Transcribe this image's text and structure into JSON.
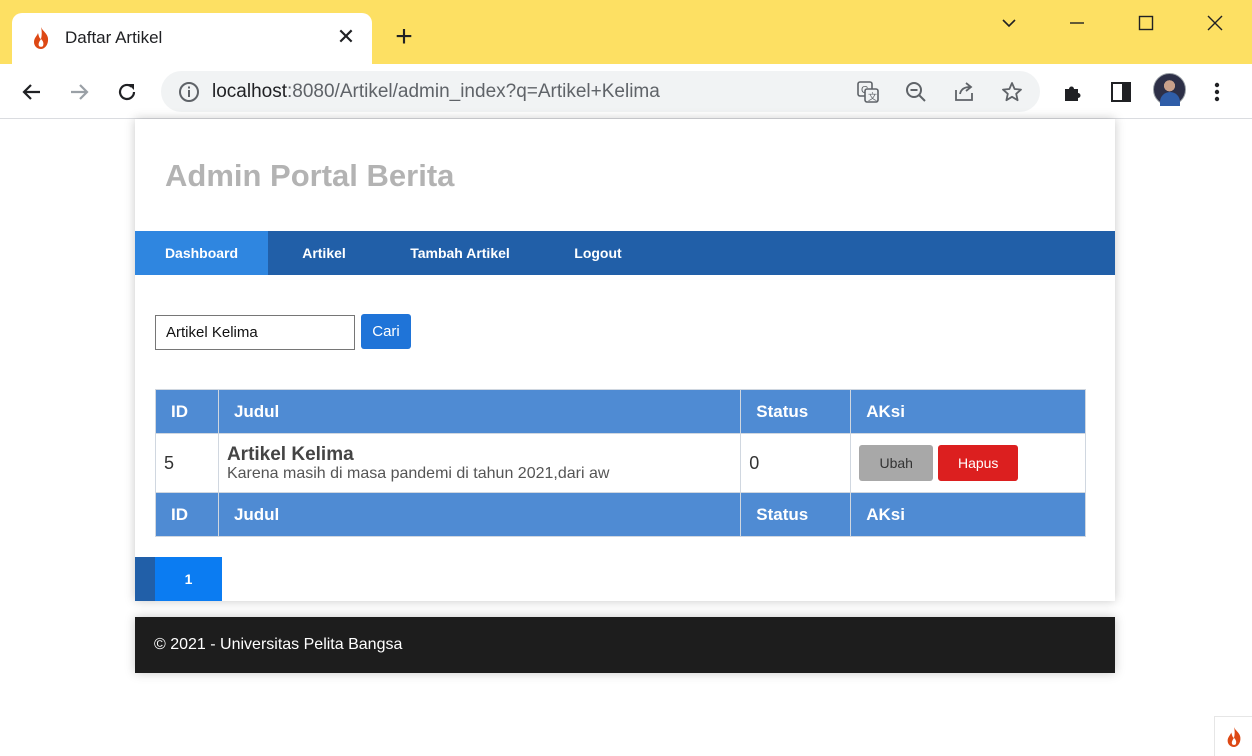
{
  "browser": {
    "tab_title": "Daftar Artikel",
    "tab_close": "✕",
    "new_tab": "+",
    "url_host": "localhost",
    "url_rest": ":8080/Artikel/admin_index?q=Artikel+Kelima",
    "colors": {
      "titlebar": "#fde063",
      "omnibox": "#f1f3f4"
    }
  },
  "site": {
    "title": "Admin Portal Berita",
    "nav": [
      {
        "label": "Dashboard",
        "active": true
      },
      {
        "label": "Artikel",
        "active": false
      },
      {
        "label": "Tambah Artikel",
        "active": false
      },
      {
        "label": "Logout",
        "active": false
      }
    ],
    "colors": {
      "nav": "#215fa8",
      "nav_active": "#2f86e0",
      "table_header": "#4f8bd3",
      "danger": "#dc1f1f"
    }
  },
  "search": {
    "value": "Artikel Kelima",
    "button": "Cari"
  },
  "table": {
    "headers": [
      "ID",
      "Judul",
      "Status",
      "AKsi"
    ],
    "rows": [
      {
        "id": "5",
        "judul": "Artikel Kelima",
        "desc": "Karena masih di masa pandemi di tahun 2021,dari aw",
        "status": "0",
        "edit_label": "Ubah",
        "delete_label": "Hapus"
      }
    ],
    "footer_headers": [
      "ID",
      "Judul",
      "Status",
      "AKsi"
    ]
  },
  "pagination": {
    "current_page": "1"
  },
  "footer": {
    "text": "© 2021 - Universitas Pelita Bangsa"
  },
  "icons": [
    "codeigniter-flame-icon",
    "back-arrow-icon",
    "forward-arrow-icon",
    "reload-icon",
    "site-info-icon",
    "translate-icon",
    "zoom-out-icon",
    "share-icon",
    "bookmark-star-icon",
    "extensions-icon",
    "side-panel-icon",
    "menu-dots-icon",
    "minimize-icon",
    "maximize-icon",
    "close-window-icon",
    "tab-search-icon"
  ]
}
